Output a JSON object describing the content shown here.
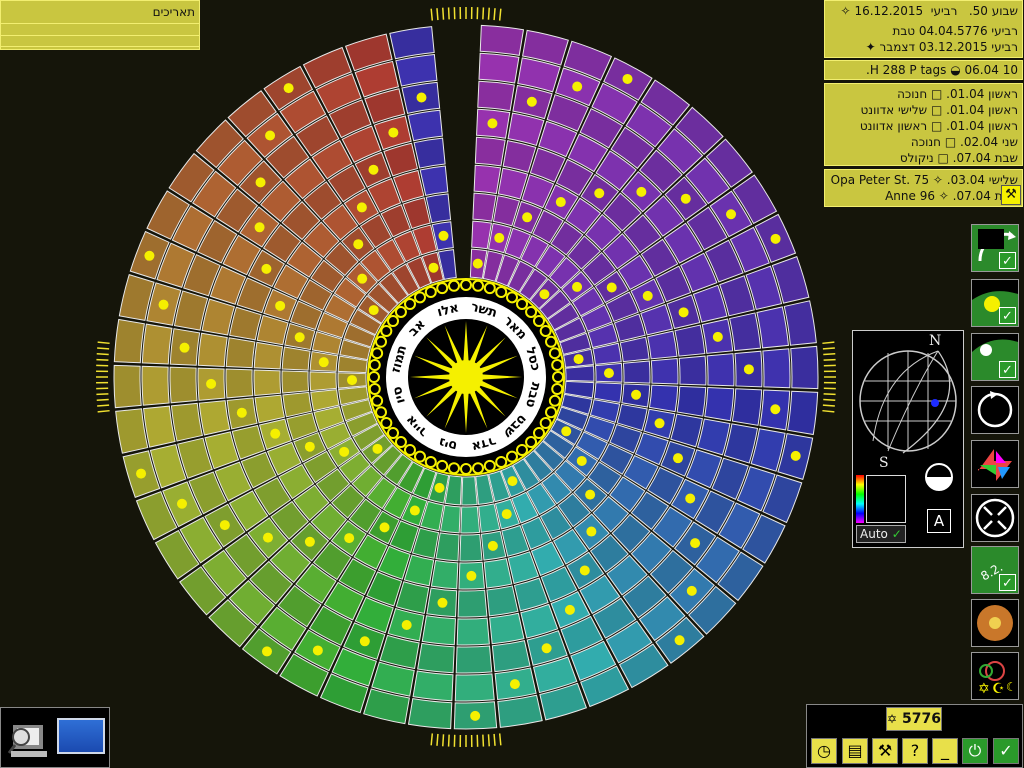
{
  "dates_panel": {
    "title": "תאריכים"
  },
  "info": {
    "week_label": "שבוע 50.",
    "weekday_1": "רביעי",
    "gregorian_date": "16.12.2015",
    "hebrew_date": "רביעי 04.04.5776 טבת",
    "julian_date": "רביעי 03.12.2015 דצמבר",
    "moon_date": "06.04.",
    "moon_info": "10 H 288 P tags"
  },
  "holidays": [
    {
      "date": "01.04.",
      "weekday": "ראשון",
      "name": "חנוכה"
    },
    {
      "date": "01.04.",
      "weekday": "ראשון",
      "name": "שלישי אדוונט"
    },
    {
      "date": "01.04.",
      "weekday": "ראשון",
      "name": "ראשון אדוונט"
    },
    {
      "date": "02.04.",
      "weekday": "שני",
      "name": "חנוכה"
    },
    {
      "date": "07.04.",
      "weekday": "שבת",
      "name": "ניקולס"
    }
  ],
  "birthdays": [
    {
      "date": "03.04.",
      "weekday": "שלישי",
      "name": "Opa Peter St. 75"
    },
    {
      "date": "07.04.",
      "weekday": "שבת",
      "name": "Anne 96"
    }
  ],
  "wheel": {
    "months": [
      "תשר",
      "מאר",
      "כסל",
      "טבת",
      "שבט",
      "אדר",
      "ניס",
      "אייר",
      "סיו",
      "תמוז",
      "אב",
      "אלו"
    ],
    "months_display": [
      "אלו",
      "תשר",
      "מאר",
      "כסל",
      "טבת",
      "שבט",
      "אדר",
      "ניס",
      "אייר",
      "סיו",
      "תמוז",
      "אב"
    ]
  },
  "sphere_widget": {
    "north": "N",
    "south": "S",
    "auto_label": "Auto",
    "a_label": "A"
  },
  "year_badge": {
    "value": "5776",
    "icon": "star-of-david-icon"
  },
  "toolbar": [
    "clock-icon",
    "book-icon",
    "tools-icon",
    "help-icon",
    "minimize-icon",
    "power-icon",
    "check-icon"
  ],
  "colors": {
    "panel": "#c9c640",
    "accent": "#f5f000",
    "check": "#2a9a2a"
  }
}
